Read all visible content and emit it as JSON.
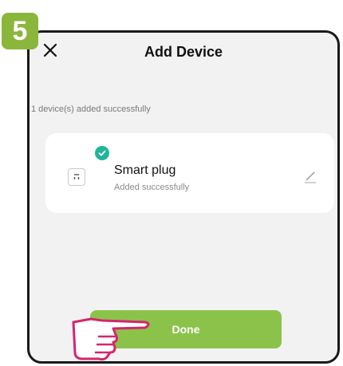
{
  "step": {
    "number": "5",
    "color": "#8bb63c"
  },
  "header": {
    "title": "Add Device",
    "close_icon": "close-icon"
  },
  "summary": {
    "text": "1 device(s) added successfully"
  },
  "device": {
    "name": "Smart plug",
    "status": "Added successfully",
    "icon": "smart-plug-icon",
    "status_color": "#1fb59b"
  },
  "actions": {
    "done_label": "Done",
    "done_color": "#8bc34a"
  },
  "annotation": {
    "hand_icon": "pointing-hand-icon",
    "hand_color": "#d6246e"
  }
}
